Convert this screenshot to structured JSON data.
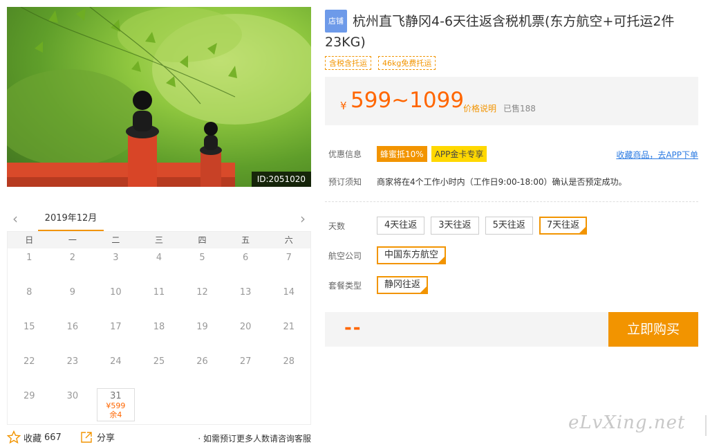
{
  "hero": {
    "id_label": "ID:2051020"
  },
  "calendar": {
    "month": "2019年12月",
    "weekdays": [
      "日",
      "一",
      "二",
      "三",
      "四",
      "五",
      "六"
    ],
    "days": [
      "1",
      "2",
      "3",
      "4",
      "5",
      "6",
      "7",
      "8",
      "9",
      "10",
      "11",
      "12",
      "13",
      "14",
      "15",
      "16",
      "17",
      "18",
      "19",
      "20",
      "21",
      "22",
      "23",
      "24",
      "25",
      "26",
      "27",
      "28",
      "29",
      "30",
      "31"
    ],
    "available": {
      "day": "31",
      "price": "¥599",
      "remaining": "余4"
    }
  },
  "footer": {
    "fav_label": "收藏",
    "fav_count": "667",
    "share_label": "分享",
    "consult": "如需预订更多人数请咨询客服"
  },
  "product": {
    "shop_badge": "店铺",
    "title": "杭州直飞静冈4-6天往返含税机票(东方航空+可托运2件23KG)",
    "tags": [
      "含税含托运",
      "46kg免费托运"
    ],
    "currency": "¥",
    "price": "599~1099",
    "price_desc": "价格说明",
    "sold": "已售188"
  },
  "promo": {
    "label": "优惠信息",
    "badge1": "蜂蜜抵10%",
    "badge2": "APP金卡专享",
    "app_link": "收藏商品，去APP下单"
  },
  "notice": {
    "label": "预订须知",
    "text": "商家将在4个工作小时内（工作日9:00-18:00）确认是否预定成功。"
  },
  "options": {
    "days_label": "天数",
    "days": [
      "4天往返",
      "3天往返",
      "5天往返",
      "7天往返"
    ],
    "airline_label": "航空公司",
    "airline": "中国东方航空",
    "package_label": "套餐类型",
    "package": "静冈往返"
  },
  "buy": {
    "total": "--",
    "button": "立即购买"
  },
  "watermark": "eLvXing.net",
  "colors": {
    "accent": "#f29400",
    "price": "#ff6600",
    "link": "#2a7ae2",
    "shop_badge": "#6d9ae9"
  }
}
